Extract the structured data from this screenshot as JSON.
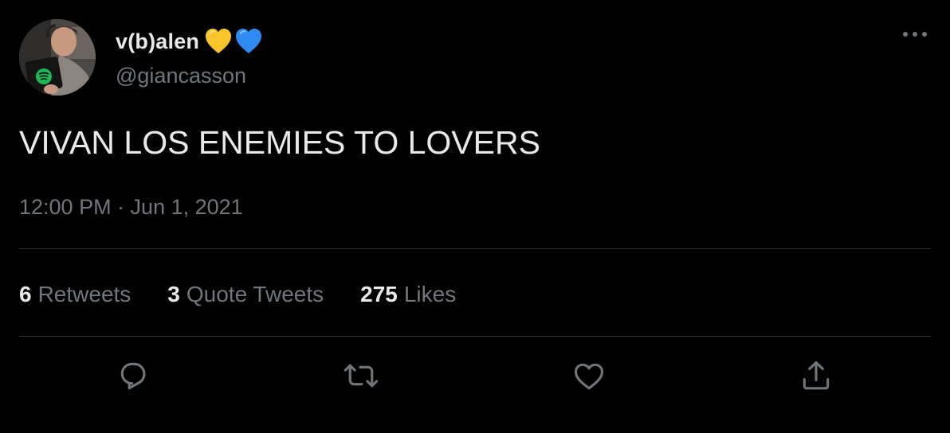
{
  "author": {
    "display_name": "v(b)alen",
    "name_emojis": [
      "yellow-heart",
      "blue-heart"
    ],
    "handle": "@giancasson"
  },
  "tweet": {
    "text": "VIVAN LOS ENEMIES TO LOVERS",
    "timestamp": "12:00 PM · Jun 1, 2021"
  },
  "stats": {
    "retweets_count": "6",
    "retweets_label": "Retweets",
    "quotes_count": "3",
    "quotes_label": "Quote Tweets",
    "likes_count": "275",
    "likes_label": "Likes"
  },
  "actions": [
    "reply-icon",
    "retweet-icon",
    "like-icon",
    "share-icon"
  ],
  "colors": {
    "background": "#000000",
    "primary_text": "#e7e9ea",
    "secondary_text": "#71767b",
    "divider": "#2f3336",
    "yellow_heart": "#f7c52b",
    "blue_heart": "#2e8bf0",
    "spotify_green": "#1db954"
  }
}
